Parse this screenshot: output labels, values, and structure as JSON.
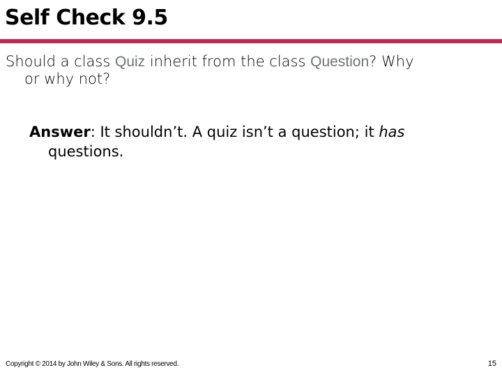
{
  "slide": {
    "title": "Self Check 9.5",
    "accent_color": "#be2754",
    "code_color": "#6d7370",
    "question": {
      "part1": "Should a class ",
      "code1": "Quiz",
      "part2": " inherit from the class ",
      "code2": "Question",
      "part3": "? Why",
      "line2": "or why not?"
    },
    "answer": {
      "label": "Answer",
      "colon": ":",
      "text1": " It shouldn’t. A quiz isn’t a question; it ",
      "emphasis": "has",
      "line2": "questions."
    },
    "footer": {
      "copyright": "Copyright © 2014 by John Wiley & Sons.  All rights reserved.",
      "page_number": "15"
    }
  }
}
